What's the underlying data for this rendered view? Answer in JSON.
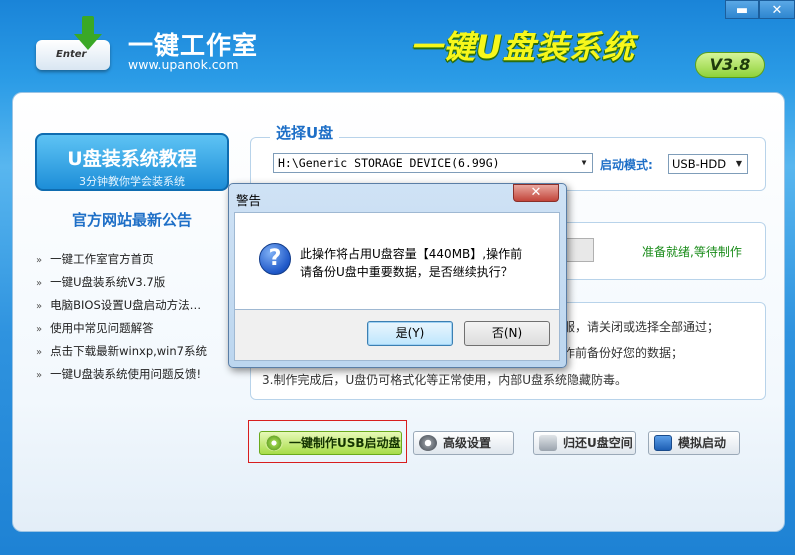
{
  "header": {
    "brand_name": "一键工作室",
    "brand_url": "www.upanok.com",
    "logo_key_text": "Enter",
    "app_title": "一键U盘装系统",
    "version": "V3.8",
    "minimize_icon": "▬",
    "close_icon": "✕"
  },
  "sidebar": {
    "tutorial_title": "U盘装系统教程",
    "tutorial_subtitle": "3分钟教你学会装系统",
    "news_title": "官方网站最新公告",
    "news_items": [
      "一键工作室官方首页",
      "一键U盘装系统V3.7版",
      "电脑BIOS设置U盘启动方法…",
      "使用中常见问题解答",
      "点击下载最新winxp,win7系统",
      "一键U盘装系统使用问题反馈!"
    ],
    "bullet": "»"
  },
  "select_usb": {
    "legend": "选择U盘",
    "drive_value": "H:\\Generic STORAGE DEVICE(6.99G)",
    "mode_label": "启动模式:",
    "mode_value": "USB-HDD"
  },
  "progress": {
    "status_text": "准备就绪,等待制作"
  },
  "notes": {
    "line1": "服，请关闭或选择全部通过；",
    "line2": "作前备份好您的数据；",
    "line3": "3.制作完成后，U盘仍可格式化等正常使用，内部U盘系统隐藏防毒。"
  },
  "actions": {
    "make_usb": "一键制作USB启动盘",
    "advanced": "高级设置",
    "restore": "归还U盘空间",
    "simulate": "模拟启动"
  },
  "dialog": {
    "title": "警告",
    "close_icon": "✕",
    "icon": "?",
    "message_line1": "此操作将占用U盘容量【440MB】,操作前",
    "message_line2": "请备份U盘中重要数据，是否继续执行？",
    "yes_label": "是(Y)",
    "no_label": "否(N)"
  },
  "colors": {
    "accent_blue": "#1e6fc7",
    "status_green": "#1a8c1a",
    "title_yellow": "#f7f71b",
    "highlight_red": "#d81e1e"
  }
}
